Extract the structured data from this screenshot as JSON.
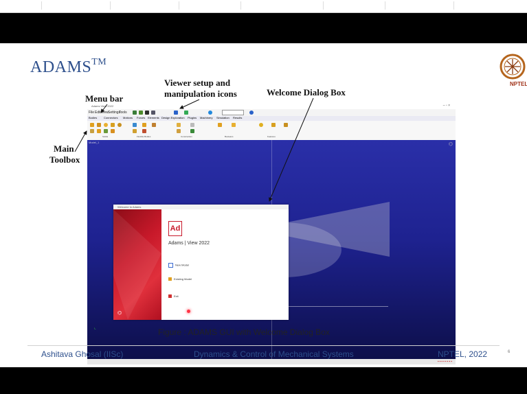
{
  "slide": {
    "title": "ADAMS",
    "title_sup": "TM",
    "logo_text": "NPTEL, IISc",
    "annotations": {
      "menu_bar": "Menu bar",
      "viewer_line1": "Viewer setup and",
      "viewer_line2": "manipulation icons",
      "welcome": "Welcome Dialog Box",
      "main_line1": "Main",
      "main_line2": "Toolbox"
    },
    "screenshot": {
      "window_title": "Adams View 2022",
      "menu_items": [
        "File",
        "Edit",
        "View",
        "Settings",
        "Tools"
      ],
      "tabs": [
        "Bodies",
        "Connectors",
        "Motions",
        "Forces",
        "Elements",
        "Design Exploration",
        "Plugins",
        "Machinery",
        "Simulation",
        "Results"
      ],
      "ribbon_groups": [
        "Solids",
        "Flexible Bodies",
        "Construction",
        "Booleans",
        "Features"
      ],
      "viewport_label": "Model_1",
      "dialog": {
        "title": "Welcome to Adams",
        "logo": "Ad",
        "product": "Adams | View 2022",
        "items": [
          "New Model",
          "Existing Model",
          "Exit"
        ]
      }
    },
    "caption": "Figure : ADAMS GUI with Welcome Dialog Box",
    "footer": {
      "left": "Ashitava Ghosal (IISc)",
      "center": "Dynamics & Control of Mechanical Systems",
      "right": "NPTEL, 2022",
      "page": "6"
    },
    "colors": {
      "title": "#2d4f8c",
      "footer": "#2d4f8c",
      "adams_red": "#c8192a",
      "viewport": "#1e2290"
    }
  }
}
